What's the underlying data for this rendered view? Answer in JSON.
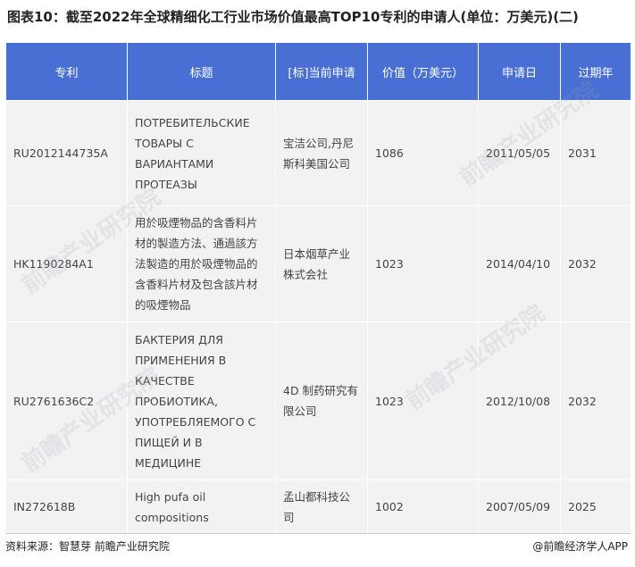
{
  "title": "图表10：截至2022年全球精细化工行业市场价值最高TOP10专利的申请人(单位：万美元)(二)",
  "headers": [
    "专利",
    "标题",
    "[标]当前申请",
    "价值（万美元）",
    "申请日",
    "过期年"
  ],
  "rows": [
    {
      "patent": "RU2012144735A",
      "title": "ПОТРЕБИТЕЛЬСКИЕ ТОВАРЫ С ВАРИАНТАМИ ПРОТЕАЗЫ",
      "applicant": "宝洁公司,丹尼斯科美国公司",
      "value": "1086",
      "date": "2011/05/05",
      "expiry": "2031"
    },
    {
      "patent": "HK1190284A1",
      "title": "用於吸煙物品的含香料片材的製造方法、通過該方法製造的用於吸煙物品的含香料片材及包含該片材的吸煙物品",
      "applicant": "日本烟草产业株式会社",
      "value": "1023",
      "date": "2014/04/10",
      "expiry": "2032"
    },
    {
      "patent": "RU2761636C2",
      "title": "БАКТЕРИЯ  ДЛЯ ПРИМЕНЕНИЯ В КАЧЕСТВЕ ПРОБИОТИКА, УПОТРЕБЛЯЕМОГО С ПИЩЕЙ И В МЕДИЦИНЕ",
      "applicant": "4D 制药研究有限公司",
      "value": "1023",
      "date": "2012/10/08",
      "expiry": "2032"
    },
    {
      "patent": "IN272618B",
      "title": "High pufa oil compositions",
      "applicant": "孟山都科技公司",
      "value": "1002",
      "date": "2007/05/09",
      "expiry": "2025"
    }
  ],
  "footer": {
    "source": "资料来源：智慧芽 前瞻产业研究院",
    "brand": "@前瞻经济学人APP"
  },
  "watermark": "前瞻产业研究院",
  "colors": {
    "header_bg": "#4a6fd4",
    "cell_bg": "#f2f2f2"
  }
}
